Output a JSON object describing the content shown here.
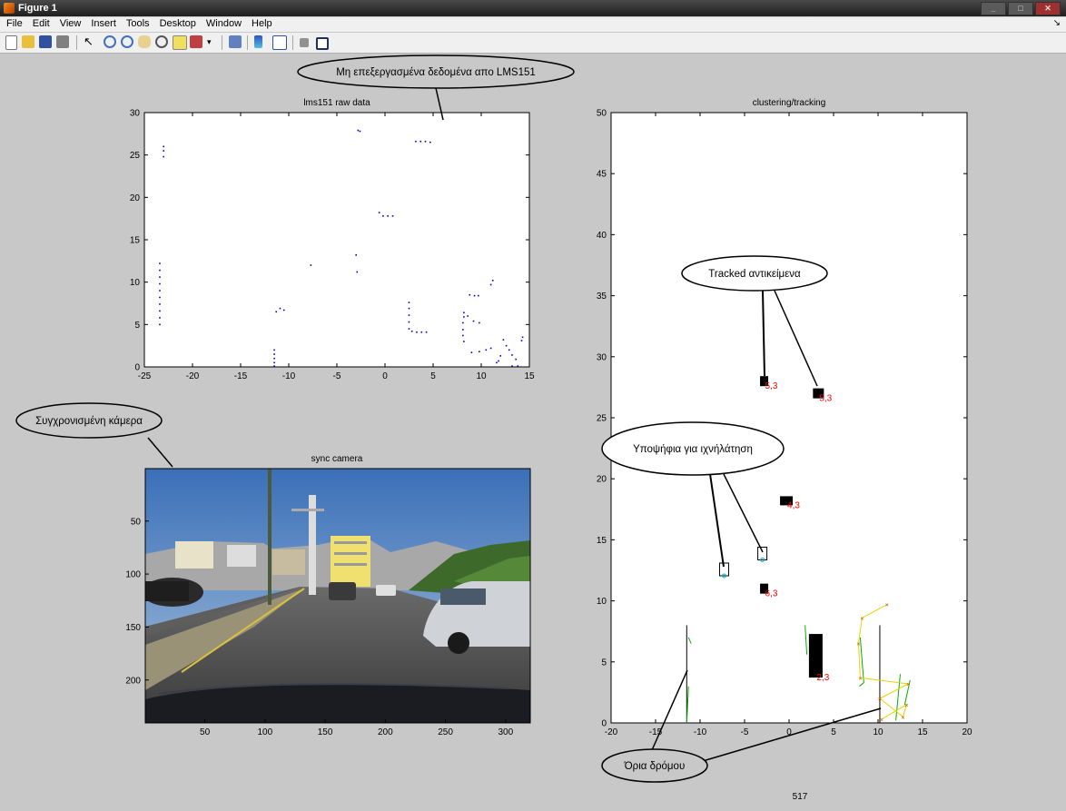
{
  "window": {
    "title": "Figure 1",
    "controls": [
      "_",
      "□",
      "✕"
    ]
  },
  "menu": [
    "File",
    "Edit",
    "View",
    "Insert",
    "Tools",
    "Desktop",
    "Window",
    "Help"
  ],
  "toolbar": [
    "new-figure-icon",
    "open-file-icon",
    "save-icon",
    "print-icon",
    "pointer-icon",
    "zoom-in-icon",
    "zoom-out-icon",
    "pan-hand-icon",
    "rotate-3d-icon",
    "data-cursor-icon",
    "brush-icon",
    "link-icon",
    "colorbar-icon",
    "legend-icon",
    "hide-plot-tools-icon",
    "show-plot-tools-icon"
  ],
  "colors": {
    "raw_points": "#0000cc",
    "track_label": "#ff0000",
    "road_green": "#00b000",
    "road_yellow": "#e6d200",
    "marker_cyan": "#00b0c0",
    "callout_line": "#000000",
    "figure_bg": "#c8c8c8"
  },
  "callouts": {
    "raw": "Μη επεξεργασμένα δεδομένα απο LMS151",
    "camera": "Συγχρονισμένη κάμερα",
    "tracked": "Tracked αντικείμενα",
    "candidates": "Υποψήφια για ιχνήλάτηση",
    "road": "Όρια δρόμου"
  },
  "frame_number": "517",
  "chart_data": [
    {
      "type": "scatter",
      "title": "lms151 raw data",
      "xlim": [
        -25,
        15
      ],
      "ylim": [
        0,
        30
      ],
      "xticks": [
        -25,
        -20,
        -15,
        -10,
        -5,
        0,
        5,
        10,
        15
      ],
      "yticks": [
        0,
        5,
        10,
        15,
        20,
        25,
        30
      ],
      "grid": false,
      "series": [
        {
          "points": [
            [
              -23.4,
              5.0
            ],
            [
              -23.4,
              5.8
            ],
            [
              -23.4,
              6.6
            ],
            [
              -23.4,
              7.4
            ],
            [
              -23.4,
              8.2
            ],
            [
              -23.4,
              9.0
            ],
            [
              -23.4,
              9.8
            ],
            [
              -23.4,
              10.6
            ],
            [
              -23.4,
              11.4
            ],
            [
              -23.4,
              12.2
            ],
            [
              -23.0,
              25.5
            ],
            [
              -23.0,
              26.0
            ],
            [
              -23.0,
              24.8
            ],
            [
              -11.5,
              0.1
            ],
            [
              -11.5,
              0.5
            ],
            [
              -11.5,
              1.0
            ],
            [
              -11.5,
              1.5
            ],
            [
              -11.5,
              2.0
            ],
            [
              -11.3,
              6.5
            ],
            [
              -10.9,
              6.9
            ],
            [
              -10.5,
              6.7
            ],
            [
              -7.7,
              12.0
            ],
            [
              -3.0,
              13.2
            ],
            [
              -2.9,
              11.2
            ],
            [
              -2.8,
              27.9
            ],
            [
              -2.6,
              27.8
            ],
            [
              -0.6,
              18.2
            ],
            [
              -0.2,
              17.8
            ],
            [
              0.3,
              17.8
            ],
            [
              0.8,
              17.8
            ],
            [
              3.2,
              26.6
            ],
            [
              3.7,
              26.6
            ],
            [
              4.2,
              26.6
            ],
            [
              4.7,
              26.5
            ],
            [
              2.5,
              4.5
            ],
            [
              2.5,
              5.3
            ],
            [
              2.5,
              6.1
            ],
            [
              2.5,
              6.9
            ],
            [
              2.5,
              7.6
            ],
            [
              2.8,
              4.2
            ],
            [
              3.3,
              4.1
            ],
            [
              3.8,
              4.1
            ],
            [
              4.3,
              4.1
            ],
            [
              8.2,
              3.0
            ],
            [
              8.1,
              3.7
            ],
            [
              8.1,
              4.4
            ],
            [
              8.1,
              5.2
            ],
            [
              8.2,
              5.9
            ],
            [
              8.2,
              6.4
            ],
            [
              8.6,
              6.0
            ],
            [
              9.2,
              5.4
            ],
            [
              9.8,
              5.2
            ],
            [
              8.8,
              8.5
            ],
            [
              9.3,
              8.4
            ],
            [
              9.7,
              8.4
            ],
            [
              11.0,
              9.7
            ],
            [
              11.2,
              10.2
            ],
            [
              9.0,
              1.7
            ],
            [
              9.8,
              1.8
            ],
            [
              10.5,
              2.0
            ],
            [
              11.0,
              2.2
            ],
            [
              12.3,
              3.2
            ],
            [
              12.6,
              2.5
            ],
            [
              12.9,
              2.0
            ],
            [
              13.2,
              1.4
            ],
            [
              13.6,
              0.9
            ],
            [
              13.2,
              0.1
            ],
            [
              13.8,
              0.1
            ],
            [
              14.2,
              3.1
            ],
            [
              14.3,
              3.5
            ],
            [
              11.6,
              0.5
            ],
            [
              11.8,
              0.7
            ],
            [
              12.0,
              1.3
            ]
          ]
        }
      ]
    },
    {
      "type": "scatter",
      "title": "clustering/tracking",
      "xlim": [
        -20,
        20
      ],
      "ylim": [
        0,
        50
      ],
      "xticks": [
        -20,
        -15,
        -10,
        -5,
        0,
        5,
        10,
        15,
        20
      ],
      "yticks": [
        0,
        5,
        10,
        15,
        20,
        25,
        30,
        35,
        40,
        45,
        50
      ],
      "grid": false,
      "tracked_objects": [
        {
          "x": -2.8,
          "y": 28.0,
          "label": "5,3"
        },
        {
          "x": 3.3,
          "y": 27.0,
          "label": "5,3"
        },
        {
          "x": -0.3,
          "y": 18.2,
          "label": "4,3"
        },
        {
          "x": -2.8,
          "y": 11.0,
          "label": "6,3"
        },
        {
          "x": 3.0,
          "y": 5.5,
          "label": "2,3"
        }
      ],
      "candidate_objects": [
        {
          "x": -7.3,
          "y": 12.5
        },
        {
          "x": -3.0,
          "y": 13.8
        }
      ],
      "road_boundaries": [
        {
          "x": -11.5,
          "y": [
            0,
            8
          ]
        },
        {
          "x": 10.2,
          "y": [
            0,
            8
          ]
        }
      ],
      "green_segments": [
        [
          [
            -11.5,
            0
          ],
          [
            -11.3,
            3
          ]
        ],
        [
          [
            -11.0,
            6.5
          ],
          [
            -11.3,
            7.0
          ]
        ],
        [
          [
            1.8,
            8.0
          ],
          [
            2.0,
            5.6
          ]
        ],
        [
          [
            8.0,
            7.0
          ],
          [
            8.4,
            3.3
          ],
          [
            7.9,
            3.0
          ]
        ],
        [
          [
            12.0,
            0.2
          ],
          [
            12.5,
            4.0
          ]
        ],
        [
          [
            13.0,
            1.5
          ],
          [
            13.6,
            3.5
          ]
        ]
      ],
      "yellow_polyline": [
        [
          11.0,
          9.7
        ],
        [
          8.2,
          8.6
        ],
        [
          7.8,
          6.5
        ],
        [
          8.0,
          3.7
        ],
        [
          13.4,
          3.2
        ],
        [
          10.2,
          2.0
        ],
        [
          12.8,
          0.5
        ],
        [
          13.2,
          1.5
        ],
        [
          10.4,
          0.3
        ]
      ]
    },
    {
      "type": "image",
      "title": "sync camera",
      "xlim": [
        0.5,
        320.5
      ],
      "ylim": [
        0.5,
        240.5
      ],
      "xticks": [
        50,
        100,
        150,
        200,
        250,
        300
      ],
      "yticks": [
        50,
        100,
        150,
        200
      ],
      "y_reversed": true
    }
  ]
}
